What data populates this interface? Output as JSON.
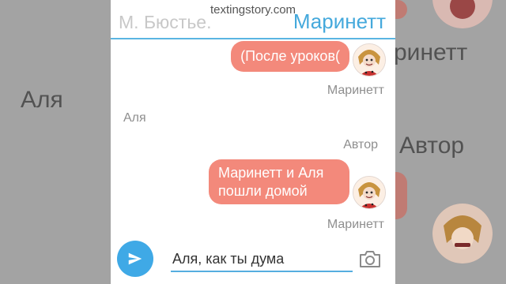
{
  "watermark": "textingstory.com",
  "header": {
    "left_contact": "М. Бюстье.",
    "right_contact": "Маринетт"
  },
  "messages": [
    {
      "text": "(После уроков(",
      "sender": "Маринетт"
    },
    {
      "sender": "Аля"
    },
    {
      "sender": "Автор"
    },
    {
      "text": "Маринетт и Аля пошли домой",
      "sender": "Маринетт"
    }
  ],
  "composer": {
    "input_value": "Аля, как ты дума",
    "send_icon": "send-icon",
    "camera_icon": "camera-icon"
  },
  "background": {
    "left_text": "Аля",
    "right_text_1": "ринетт",
    "right_text_2": "Автор"
  },
  "colors": {
    "accent": "#45a9dc",
    "bubble": "#f3897b",
    "send_button": "#3fa9e6"
  }
}
